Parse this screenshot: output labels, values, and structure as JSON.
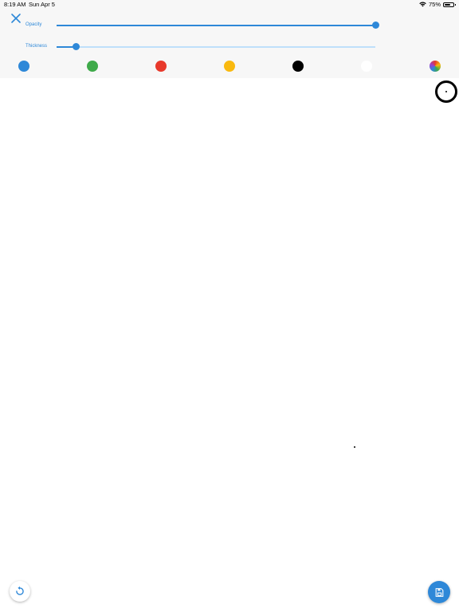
{
  "status_bar": {
    "time": "8:19 AM",
    "date": "Sun Apr 5",
    "battery_percent": "75%",
    "battery_level": 0.75,
    "wifi_icon": "wifi-icon"
  },
  "toolbar": {
    "close_icon": "close-icon",
    "opacity": {
      "label": "Opacity",
      "value": 1.0
    },
    "thickness": {
      "label": "Thickness",
      "value": 0.06
    },
    "colors": {
      "blue": "#2e88d8",
      "green": "#3faa4a",
      "red": "#e8392b",
      "yellow": "#f9b90f",
      "black": "#000000",
      "white": "#ffffff",
      "custom": "color-wheel-icon"
    },
    "accent": "#2e88d8",
    "track": "#bfe0fb"
  },
  "actions": {
    "undo_icon": "undo-icon",
    "save_icon": "save-icon"
  }
}
